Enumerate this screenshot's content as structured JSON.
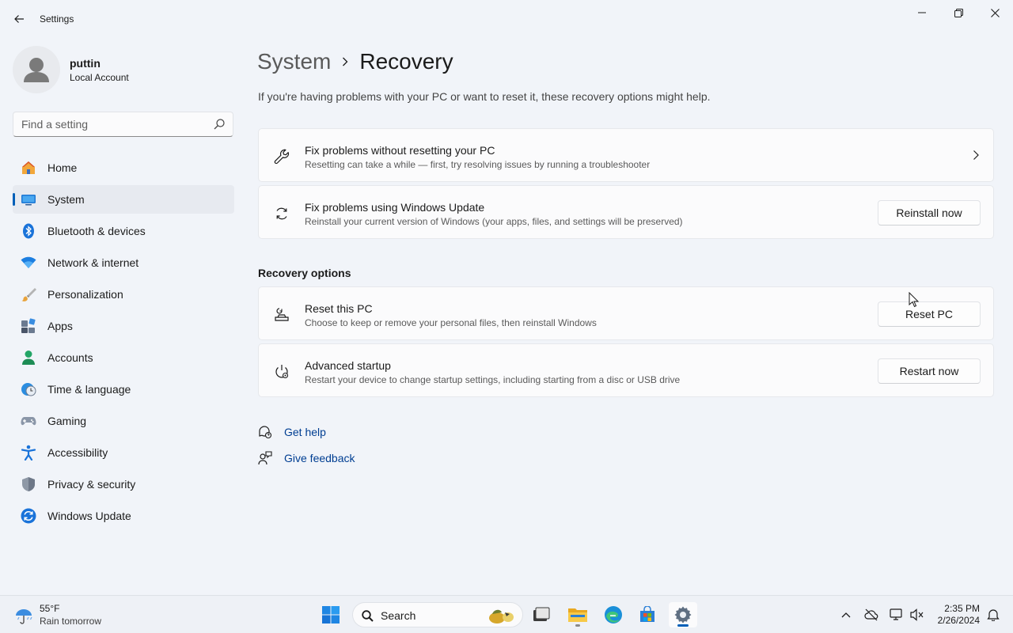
{
  "window": {
    "title": "Settings"
  },
  "user": {
    "name": "puttin",
    "account_type": "Local Account"
  },
  "search": {
    "placeholder": "Find a setting"
  },
  "nav": {
    "items": [
      {
        "label": "Home",
        "icon": "home-icon"
      },
      {
        "label": "System",
        "icon": "system-icon",
        "active": true
      },
      {
        "label": "Bluetooth & devices",
        "icon": "bluetooth-icon"
      },
      {
        "label": "Network & internet",
        "icon": "wifi-icon"
      },
      {
        "label": "Personalization",
        "icon": "brush-icon"
      },
      {
        "label": "Apps",
        "icon": "apps-icon"
      },
      {
        "label": "Accounts",
        "icon": "accounts-icon"
      },
      {
        "label": "Time & language",
        "icon": "clock-globe-icon"
      },
      {
        "label": "Gaming",
        "icon": "gamepad-icon"
      },
      {
        "label": "Accessibility",
        "icon": "accessibility-icon"
      },
      {
        "label": "Privacy & security",
        "icon": "shield-icon"
      },
      {
        "label": "Windows Update",
        "icon": "update-icon"
      }
    ]
  },
  "breadcrumb": {
    "parent": "System",
    "current": "Recovery"
  },
  "page": {
    "description": "If you're having problems with your PC or want to reset it, these recovery options might help."
  },
  "cards": {
    "troubleshoot": {
      "title": "Fix problems without resetting your PC",
      "description": "Resetting can take a while — first, try resolving issues by running a troubleshooter"
    },
    "windows_update": {
      "title": "Fix problems using Windows Update",
      "description": "Reinstall your current version of Windows (your apps, files, and settings will be preserved)",
      "button": "Reinstall now"
    }
  },
  "recovery_options": {
    "heading": "Recovery options",
    "reset": {
      "title": "Reset this PC",
      "description": "Choose to keep or remove your personal files, then reinstall Windows",
      "button": "Reset PC"
    },
    "advanced": {
      "title": "Advanced startup",
      "description": "Restart your device to change startup settings, including starting from a disc or USB drive",
      "button": "Restart now"
    }
  },
  "links": {
    "help": "Get help",
    "feedback": "Give feedback"
  },
  "taskbar": {
    "weather_temp": "55°F",
    "weather_desc": "Rain tomorrow",
    "search_label": "Search",
    "time": "2:35 PM",
    "date": "2/26/2024"
  },
  "colors": {
    "accent": "#005fb8",
    "link": "#003e92",
    "background": "#f1f4f9",
    "card": "#fbfbfc"
  }
}
